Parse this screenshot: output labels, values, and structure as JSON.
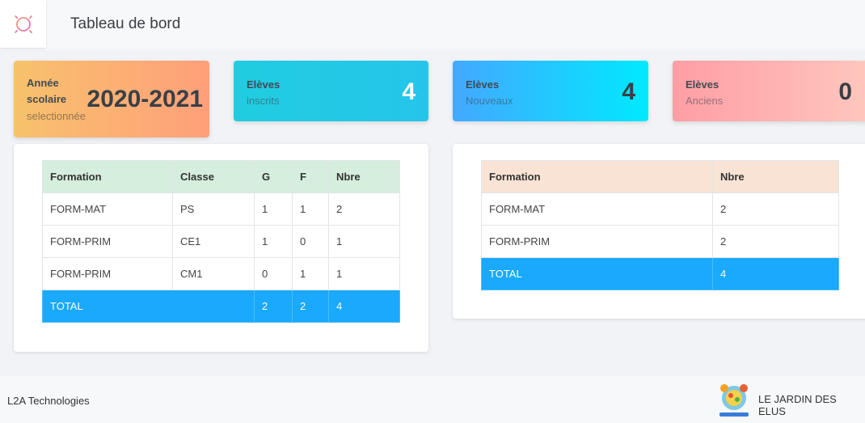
{
  "header": {
    "title": "Tableau de bord",
    "logo_icon": "sun-flower-icon"
  },
  "cards": [
    {
      "title": "Année scolaire",
      "subtitle": "selectionnée",
      "value": "2020-2021"
    },
    {
      "title": "Elèves",
      "subtitle": "inscrits",
      "value": "4"
    },
    {
      "title": "Elèves",
      "subtitle": "Nouveaux",
      "value": "4"
    },
    {
      "title": "Elèves",
      "subtitle": "Anciens",
      "value": "0"
    }
  ],
  "table_classes": {
    "headers": [
      "Formation",
      "Classe",
      "G",
      "F",
      "Nbre"
    ],
    "rows": [
      [
        "FORM-MAT",
        "PS",
        "1",
        "1",
        "2"
      ],
      [
        "FORM-PRIM",
        "CE1",
        "1",
        "0",
        "1"
      ],
      [
        "FORM-PRIM",
        "CM1",
        "0",
        "1",
        "1"
      ]
    ],
    "total": {
      "label": "TOTAL",
      "g": "2",
      "f": "2",
      "nbre": "4"
    }
  },
  "table_formations": {
    "headers": [
      "Formation",
      "Nbre"
    ],
    "rows": [
      [
        "FORM-MAT",
        "2"
      ],
      [
        "FORM-PRIM",
        "2"
      ]
    ],
    "total": {
      "label": "TOTAL",
      "nbre": "4"
    }
  },
  "footer": {
    "company": "L2A Technologies",
    "brand": "LE JARDIN DES ELUS",
    "brand_logo": "school-logo-icon"
  },
  "colors": {
    "total_row": "#1aa9fc",
    "header_green": "#d5eedd",
    "header_peach": "#f9e3d4"
  }
}
